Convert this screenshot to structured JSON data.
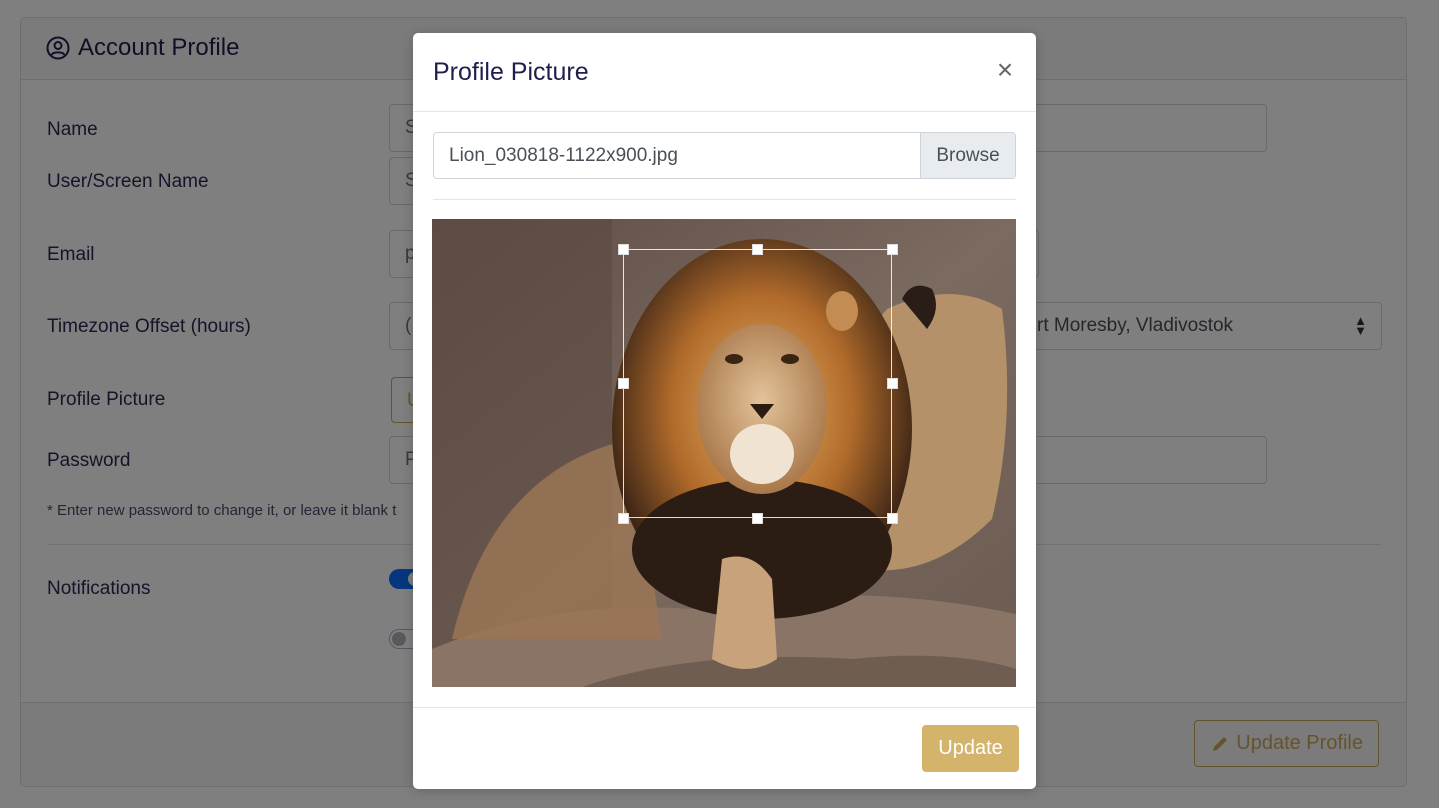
{
  "page": {
    "title": "Account Profile",
    "labels": {
      "name": "Name",
      "screen_name": "User/Screen Name",
      "email": "Email",
      "timezone": "Timezone Offset (hours)",
      "profile_picture": "Profile Picture",
      "password": "Password",
      "notifications": "Notifications"
    },
    "fields": {
      "name_partial": "S",
      "screen_name_partial": "S",
      "email_partial": "p",
      "timezone_partial": "(",
      "timezone_visible": "rt Moresby, Vladivostok",
      "upload_partial": "U",
      "password_partial": "P"
    },
    "help_text": "* Enter new password to change it, or leave it blank t",
    "update_profile_label": "Update Profile"
  },
  "modal": {
    "title": "Profile Picture",
    "close_glyph": "×",
    "file_name": "Lion_030818-1122x900.jpg",
    "browse_label": "Browse",
    "update_label": "Update"
  },
  "colors": {
    "accent_gold": "#d4b46a",
    "title_navy": "#1f1f4d",
    "toggle_blue": "#0d6efd"
  }
}
